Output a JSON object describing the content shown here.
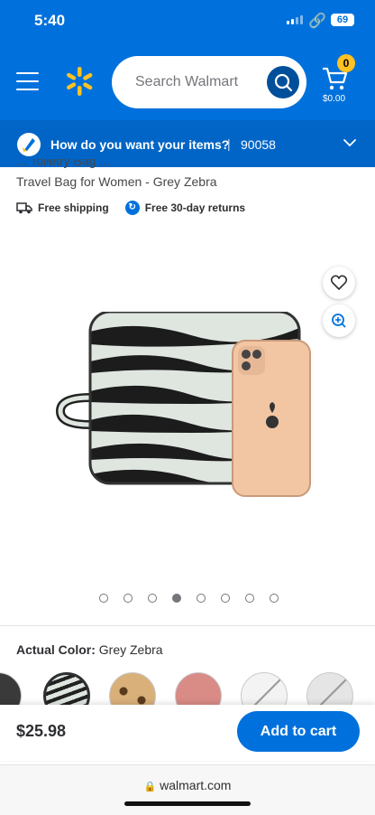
{
  "status_bar": {
    "time": "5:40",
    "battery": "69"
  },
  "header": {
    "search_placeholder": "Search Walmart",
    "cart_count": "0",
    "cart_total": "$0.00"
  },
  "delivery": {
    "question": "How do you want your items?",
    "separator": "|",
    "zip": "90058"
  },
  "product": {
    "title_line1": "... Toiletry Bag ...",
    "title_line2": "Travel Bag for Women - Grey Zebra",
    "shipping": "Free shipping",
    "returns": "Free 30-day returns",
    "image_count": 8,
    "active_image_index": 3
  },
  "color": {
    "label": "Actual Color:",
    "value": "Grey Zebra"
  },
  "purchase": {
    "price": "$25.98",
    "add_to_cart": "Add to cart"
  },
  "browser": {
    "url": "walmart.com"
  },
  "colors": {
    "brand_blue": "#0071dc",
    "spark_yellow": "#ffc220"
  }
}
